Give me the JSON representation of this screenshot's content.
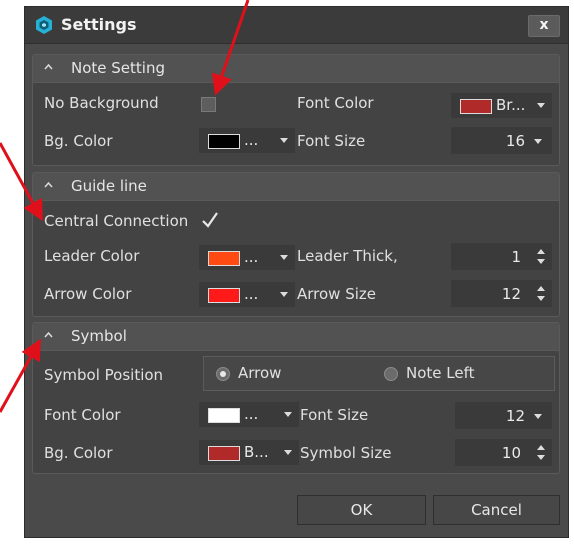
{
  "window": {
    "title": "Settings",
    "close_label": "x"
  },
  "note_setting": {
    "header": "Note Setting",
    "no_background_label": "No Background",
    "no_background_checked": false,
    "font_color_label": "Font Color",
    "font_color_value": "Br...",
    "font_color_swatch": "#b02a2a",
    "bg_color_label": "Bg. Color",
    "bg_color_value": "...",
    "bg_color_swatch": "#000000",
    "font_size_label": "Font Size",
    "font_size_value": "16"
  },
  "guide_line": {
    "header": "Guide line",
    "central_connection_label": "Central Connection",
    "central_connection_checked": true,
    "leader_color_label": "Leader Color",
    "leader_color_value": "...",
    "leader_color_swatch": "#ff4a14",
    "leader_thick_label": "Leader Thick,",
    "leader_thick_value": "1",
    "arrow_color_label": "Arrow Color",
    "arrow_color_value": "...",
    "arrow_color_swatch": "#ff1a1a",
    "arrow_size_label": "Arrow Size",
    "arrow_size_value": "12"
  },
  "symbol": {
    "header": "Symbol",
    "position_label": "Symbol Position",
    "position_options": [
      "Arrow",
      "Note Left"
    ],
    "position_selected": "Arrow",
    "font_color_label": "Font Color",
    "font_color_value": "...",
    "font_color_swatch": "#ffffff",
    "font_size_label": "Font Size",
    "font_size_value": "12",
    "bg_color_label": "Bg. Color",
    "bg_color_value": "B...",
    "bg_color_swatch": "#b02a2a",
    "symbol_size_label": "Symbol Size",
    "symbol_size_value": "10"
  },
  "buttons": {
    "ok": "OK",
    "cancel": "Cancel"
  },
  "colors": {
    "dialog_bg": "#4a4a4a",
    "titlebar_bg": "#3b3b3b",
    "group_header_bg": "#525252",
    "field_bg": "#3a3a3a",
    "annotation_arrow": "#e0101a",
    "app_icon": "#26b0d6"
  },
  "icons": [
    "app-logo-icon",
    "close-icon",
    "chevron-up-icon",
    "checkmark-icon",
    "dropdown-arrow-icon",
    "spin-arrows-icon",
    "red-annotation-arrow"
  ]
}
